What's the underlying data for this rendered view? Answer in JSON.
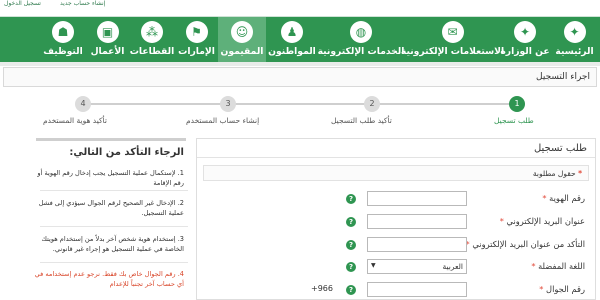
{
  "top_strip": {
    "left_text": "تسجيل الدخول",
    "right_text": "إنشاء حساب جديد"
  },
  "nav": {
    "items": [
      {
        "label": "الرئيسية",
        "icon": "emblem-icon"
      },
      {
        "label": "عن الوزارة",
        "icon": "emblem-icon"
      },
      {
        "label": "الاستعلامات الإلكترونية",
        "icon": "inquiry-icon"
      },
      {
        "label": "الخدمات الإلكترونية",
        "icon": "globe-icon"
      },
      {
        "label": "المواطنون",
        "icon": "citizen-icon"
      },
      {
        "label": "المقيمون",
        "icon": "residents-icon",
        "active": true
      },
      {
        "label": "الإمارات",
        "icon": "emirates-icon"
      },
      {
        "label": "القطاعات",
        "icon": "sectors-icon"
      },
      {
        "label": "الأعمال",
        "icon": "briefcase-icon"
      },
      {
        "label": "التوظيف",
        "icon": "employment-icon"
      }
    ]
  },
  "procedures_title": "اجراء التسجيل",
  "steps": [
    {
      "number": "1",
      "label": "طلب تسجيل",
      "state": "active"
    },
    {
      "number": "2",
      "label": "تأكيد طلب التسجيل",
      "state": "pending"
    },
    {
      "number": "3",
      "label": "إنشاء حساب المستخدم",
      "state": "pending"
    },
    {
      "number": "4",
      "label": "تأكيد هوية المستخدم",
      "state": "pending"
    }
  ],
  "form": {
    "title": "طلب تسجيل",
    "required_note": "حقول مطلوبة",
    "required_star": "*",
    "fields": [
      {
        "label": "رقم الهوية",
        "value": ""
      },
      {
        "label": "عنوان البريد الإلكتروني",
        "value": ""
      },
      {
        "label": "التأكد من عنوان البريد الإلكتروني",
        "value": ""
      },
      {
        "label": "اللغة المفضلة",
        "value": "العربية",
        "type": "select"
      },
      {
        "label": "رقم الجوال",
        "value": "",
        "prefix": "+966"
      }
    ],
    "star": "*",
    "help_glyph": "?"
  },
  "info": {
    "title": "الرجاء التأكد من التالي:",
    "items": [
      {
        "text": "1. لإستكمال عملية التسجيل يجب إدخال رقم الهوية أو رقم الإقامة",
        "color": "#333333"
      },
      {
        "text": "2. الإدخال غير الصحيح لرقم الجوال سيؤدي إلى فشل عملية التسجيل.",
        "color": "#333333"
      },
      {
        "text": "3. إستخدام هوية شخص آخر بدلاً من إستخدام هويتك الخاصة في عملية التسجيل هو إجراء غير قانوني.",
        "color": "#333333"
      },
      {
        "text": "4. رقم الجوال خاص بك فقط. نرجو عدم إستخدامه في أي حساب آخر تجنباً للإعدام",
        "color": "#d9472b"
      }
    ]
  },
  "colors": {
    "brand_green": "#2f9551",
    "active_tab": "#5eb07a",
    "required_red": "#e24b3b"
  }
}
